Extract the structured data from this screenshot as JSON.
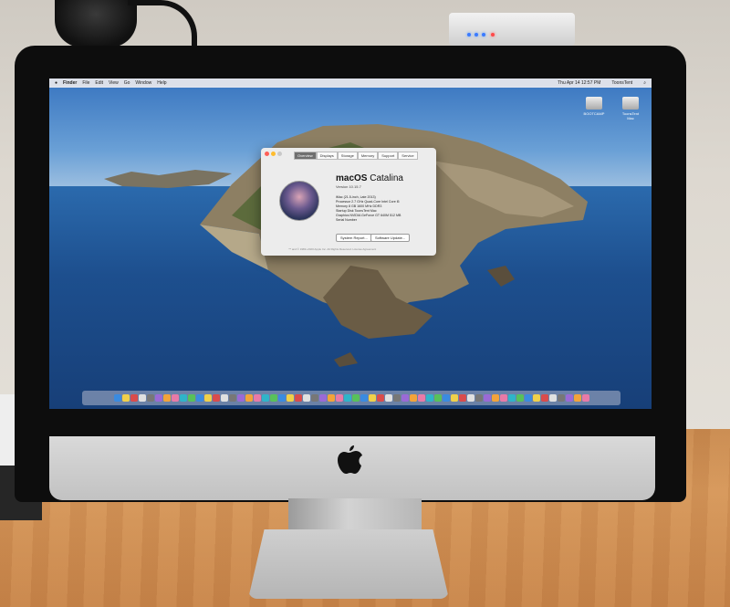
{
  "menubar": {
    "items": [
      "Finder",
      "File",
      "Edit",
      "View",
      "Go",
      "Window",
      "Help"
    ],
    "clock": "Thu Apr 14 12:57 PM",
    "user": "ToonsTent"
  },
  "desktop_icons": [
    {
      "label": "BOOTCAMP"
    },
    {
      "label": "ToonsTent Mac"
    }
  ],
  "about_window": {
    "tabs": [
      "Overview",
      "Displays",
      "Storage",
      "Memory",
      "Support",
      "Service"
    ],
    "os_name": "macOS",
    "os_variant": "Catalina",
    "version": "Version 10.15.7",
    "specs": [
      "iMac (21.5-inch, Late 2013)",
      "Processor  2.7 GHz Quad-Core Intel Core i5",
      "Memory  8 GB 1600 MHz DDR3",
      "Startup Disk  ToonsTent Mac",
      "Graphics  NVIDIA GeForce GT 640M 512 MB",
      "Serial Number"
    ],
    "buttons": {
      "system_report": "System Report...",
      "software_update": "Software Update..."
    },
    "footer": "™ and © 1983–2020 Apple Inc. All Rights Reserved. License Agreement"
  },
  "colors": {
    "accent_led_blue": "#3b7bff",
    "accent_led_red": "#ff4a4a",
    "desk_wood": "#d6975a",
    "bezel": "#0d0d0d"
  },
  "icons": [
    "apple-logo-icon",
    "dock-app-icons",
    "hard-drive-icon"
  ]
}
